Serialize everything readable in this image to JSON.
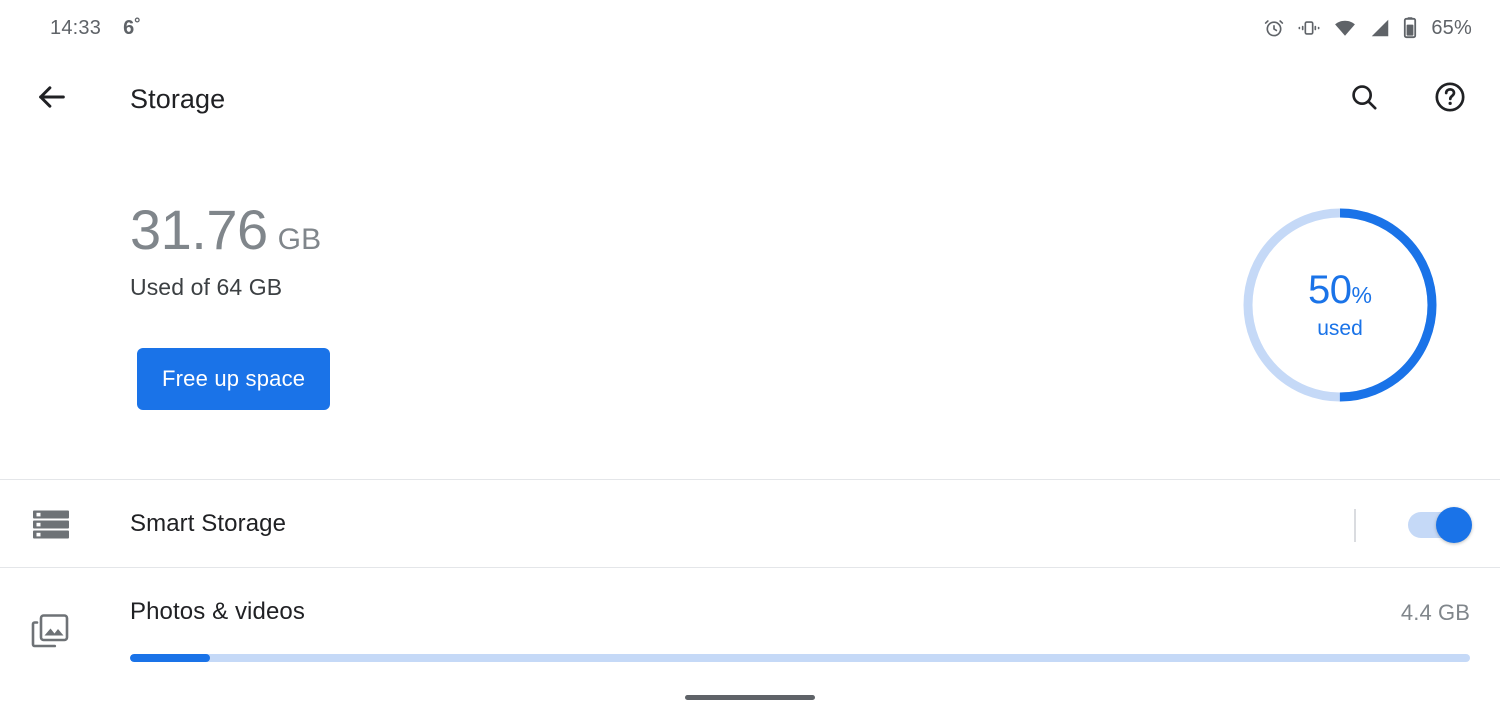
{
  "status_bar": {
    "time": "14:33",
    "temperature": "6˚",
    "battery_percent": "65%",
    "icons": [
      "alarm-icon",
      "vibrate-icon",
      "wifi-icon",
      "cellular-signal-icon",
      "battery-icon"
    ]
  },
  "app_bar": {
    "back_icon": "back-arrow-icon",
    "title": "Storage",
    "search_icon": "search-icon",
    "help_icon": "help-icon"
  },
  "summary": {
    "used_number": "31.76",
    "used_unit": "GB",
    "used_of": "Used of 64 GB",
    "free_up_label": "Free up space",
    "donut": {
      "percent_number": "50",
      "percent_sign": "%",
      "sub_label": "used",
      "used_fraction": 50,
      "used_color": "#1a73e8",
      "free_color": "#c5d9f7"
    }
  },
  "rows": [
    {
      "name": "smart-storage",
      "icon": "storage-bars-icon",
      "label": "Smart Storage",
      "toggle_on": true
    },
    {
      "name": "photos-videos",
      "icon": "photo-library-icon",
      "label": "Photos & videos",
      "size": "4.4 GB",
      "progress_percent": 6
    }
  ],
  "colors": {
    "accent": "#1a73e8",
    "accent_light": "#c5d9f7",
    "text_primary": "#202124",
    "text_secondary": "#80868b",
    "divider": "#e4e6e9"
  },
  "gesture_bar": "home-gesture-bar"
}
